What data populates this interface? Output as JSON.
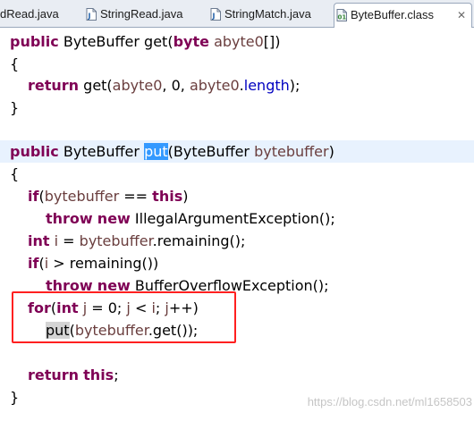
{
  "tabs": [
    {
      "label": "dRead.java",
      "icon": "java-file-icon",
      "active": false
    },
    {
      "label": "StringRead.java",
      "icon": "java-file-icon",
      "active": false
    },
    {
      "label": "StringMatch.java",
      "icon": "java-file-icon",
      "active": false
    },
    {
      "label": "ByteBuffer.class",
      "icon": "class-file-icon",
      "active": true,
      "close": "✕"
    }
  ],
  "code": {
    "lines": [
      [
        "public",
        "ByteBuffer get(",
        "byte",
        "abyte0",
        "[])"
      ],
      [
        "{"
      ],
      [
        "return",
        "get(",
        "abyte0",
        ", 0, ",
        "abyte0",
        ".",
        "length",
        ");"
      ],
      [
        "}"
      ],
      [
        "public",
        "ByteBuffer ",
        "put",
        "(ByteBuffer ",
        "bytebuffer",
        ")"
      ],
      [
        "{"
      ],
      [
        "if",
        "(",
        "bytebuffer",
        " == ",
        "this",
        ")"
      ],
      [
        "throw",
        "new",
        "IllegalArgumentException();"
      ],
      [
        "int",
        "i",
        " = ",
        "bytebuffer",
        ".remaining();"
      ],
      [
        "if",
        "(",
        "i",
        " > remaining())"
      ],
      [
        "throw",
        "new",
        "BufferOverflowException();"
      ],
      [
        "for",
        "(",
        "int",
        "j",
        " = 0; ",
        "j",
        " < ",
        "i",
        "; ",
        "j",
        "++)"
      ],
      [
        "put",
        "(",
        "bytebuffer",
        ".get());"
      ],
      [
        "return",
        "this",
        ";"
      ],
      [
        "}"
      ]
    ]
  },
  "watermark": "https://blog.csdn.net/ml1658503",
  "colors": {
    "keyword": "#7f0055",
    "variable": "#6a3e3e",
    "field": "#0000c0",
    "selection": "#3399ff",
    "highlight_line": "#e8f2fe",
    "annotation_box": "#ff2020"
  }
}
